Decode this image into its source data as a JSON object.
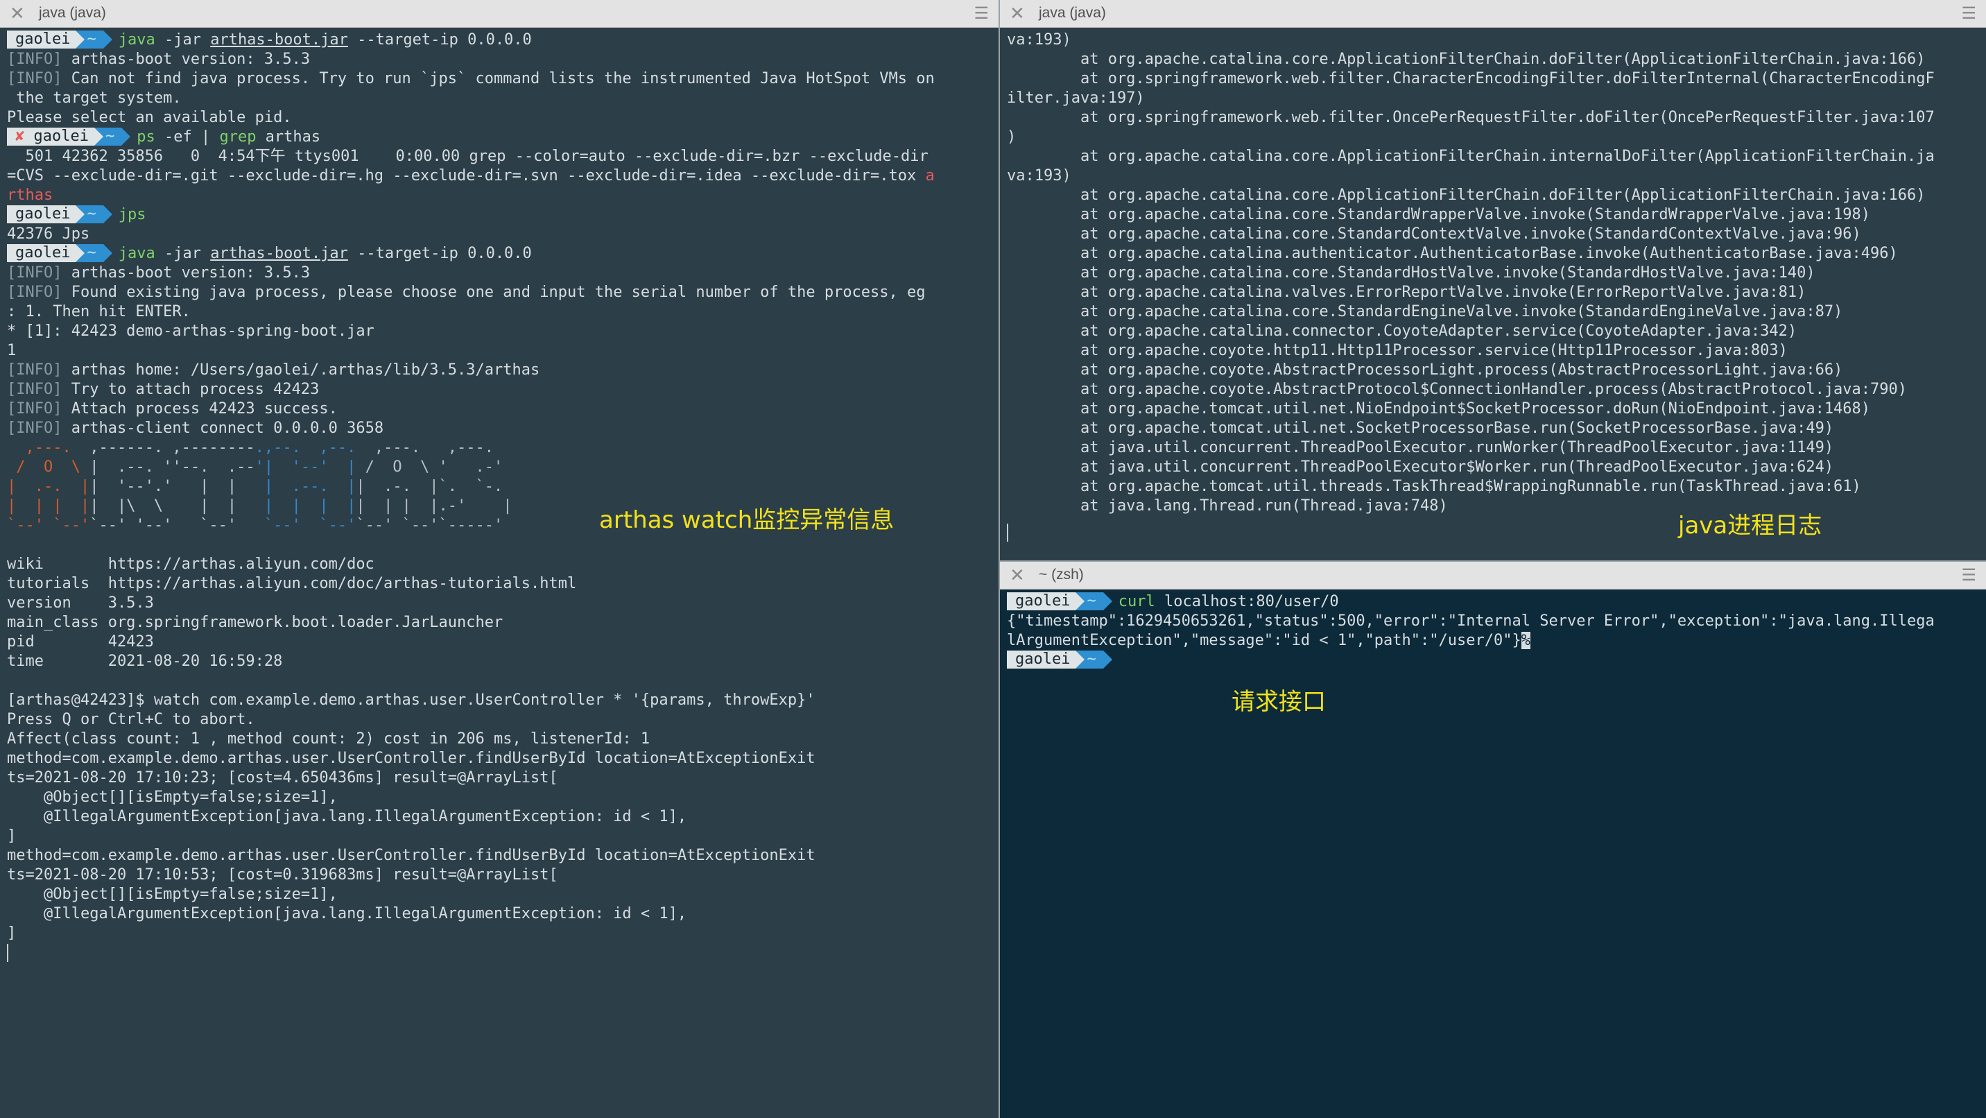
{
  "left_pane": {
    "title": "java (java)",
    "lines": [
      {
        "type": "prompt",
        "user": "gaolei",
        "dir": "~",
        "cmd": "java",
        "args_pre": " -jar ",
        "args_u": "arthas-boot.jar",
        "args_post": " --target-ip 0.0.0.0"
      },
      {
        "type": "text",
        "tag": "[INFO]",
        "text": " arthas-boot version: 3.5.3"
      },
      {
        "type": "text",
        "tag": "[INFO]",
        "text": " Can not find java process. Try to run `jps` command lists the instrumented Java HotSpot VMs on"
      },
      {
        "type": "text",
        "tag": "",
        "text": " the target system."
      },
      {
        "type": "text",
        "tag": "",
        "text": "Please select an available pid."
      },
      {
        "type": "prompt_err",
        "mark": "✘",
        "user": "gaolei",
        "dir": "~",
        "cmd": "ps",
        "args_pre": " -ef | ",
        "grep": "grep",
        "args_post": " arthas"
      },
      {
        "type": "text",
        "tag": "",
        "text": "  501 42362 35856   0  4:54下午 ttys001    0:00.00 grep --color=auto --exclude-dir=.bzr --exclude-dir"
      },
      {
        "type": "text",
        "tag": "",
        "text": "=CVS --exclude-dir=.git --exclude-dir=.hg --exclude-dir=.svn --exclude-dir=.idea --exclude-dir=.tox ",
        "red": "a"
      },
      {
        "type": "red",
        "text": "rthas"
      },
      {
        "type": "prompt",
        "user": "gaolei",
        "dir": "~",
        "cmd": "jps",
        "args_pre": "",
        "args_u": "",
        "args_post": ""
      },
      {
        "type": "text",
        "tag": "",
        "text": "42376 Jps"
      },
      {
        "type": "prompt",
        "user": "gaolei",
        "dir": "~",
        "cmd": "java",
        "args_pre": " -jar ",
        "args_u": "arthas-boot.jar",
        "args_post": " --target-ip 0.0.0.0"
      },
      {
        "type": "text",
        "tag": "[INFO]",
        "text": " arthas-boot version: 3.5.3"
      },
      {
        "type": "text",
        "tag": "[INFO]",
        "text": " Found existing java process, please choose one and input the serial number of the process, eg"
      },
      {
        "type": "text",
        "tag": "",
        "text": ": 1. Then hit ENTER."
      },
      {
        "type": "text",
        "tag": "",
        "text": "* [1]: 42423 demo-arthas-spring-boot.jar"
      },
      {
        "type": "text",
        "tag": "",
        "text": "1"
      },
      {
        "type": "text",
        "tag": "[INFO]",
        "text": " arthas home: /Users/gaolei/.arthas/lib/3.5.3/arthas"
      },
      {
        "type": "text",
        "tag": "[INFO]",
        "text": " Try to attach process 42423"
      },
      {
        "type": "text",
        "tag": "[INFO]",
        "text": " Attach process 42423 success."
      },
      {
        "type": "text",
        "tag": "[INFO]",
        "text": " arthas-client connect 0.0.0.0 3658"
      }
    ],
    "logo_lines": [
      "  ,---.  ,------. ,--------.,--.  ,--.  ,---.   ,---.",
      " /  O  \\ |  .--. ''--.  .--'|  '--'  | /  O  \\ '   .-'",
      "|  .-.  ||  '--'.'   |  |   |  .--.  ||  .-.  |`.  `-.",
      "|  | |  ||  |\\  \\    |  |   |  |  |  ||  | |  |.-'    |",
      "`--' `--'`--' '--'   `--'   `--'  `--'`--' `--'`-----'"
    ],
    "info_lines": [
      "",
      "wiki       https://arthas.aliyun.com/doc",
      "tutorials  https://arthas.aliyun.com/doc/arthas-tutorials.html",
      "version    3.5.3",
      "main_class org.springframework.boot.loader.JarLauncher",
      "pid        42423",
      "time       2021-08-20 16:59:28",
      "",
      "[arthas@42423]$ watch com.example.demo.arthas.user.UserController * '{params, throwExp}'",
      "Press Q or Ctrl+C to abort.",
      "Affect(class count: 1 , method count: 2) cost in 206 ms, listenerId: 1",
      "method=com.example.demo.arthas.user.UserController.findUserById location=AtExceptionExit",
      "ts=2021-08-20 17:10:23; [cost=4.650436ms] result=@ArrayList[",
      "    @Object[][isEmpty=false;size=1],",
      "    @IllegalArgumentException[java.lang.IllegalArgumentException: id < 1],",
      "]",
      "method=com.example.demo.arthas.user.UserController.findUserById location=AtExceptionExit",
      "ts=2021-08-20 17:10:53; [cost=0.319683ms] result=@ArrayList[",
      "    @Object[][isEmpty=false;size=1],",
      "    @IllegalArgumentException[java.lang.IllegalArgumentException: id < 1],",
      "]"
    ],
    "annotation": "arthas watch监控异常信息"
  },
  "right_top_pane": {
    "title": "java (java)",
    "lines": [
      "va:193)",
      "        at org.apache.catalina.core.ApplicationFilterChain.doFilter(ApplicationFilterChain.java:166)",
      "        at org.springframework.web.filter.CharacterEncodingFilter.doFilterInternal(CharacterEncodingF",
      "ilter.java:197)",
      "        at org.springframework.web.filter.OncePerRequestFilter.doFilter(OncePerRequestFilter.java:107",
      ")",
      "        at org.apache.catalina.core.ApplicationFilterChain.internalDoFilter(ApplicationFilterChain.ja",
      "va:193)",
      "        at org.apache.catalina.core.ApplicationFilterChain.doFilter(ApplicationFilterChain.java:166)",
      "        at org.apache.catalina.core.StandardWrapperValve.invoke(StandardWrapperValve.java:198)",
      "        at org.apache.catalina.core.StandardContextValve.invoke(StandardContextValve.java:96)",
      "        at org.apache.catalina.authenticator.AuthenticatorBase.invoke(AuthenticatorBase.java:496)",
      "        at org.apache.catalina.core.StandardHostValve.invoke(StandardHostValve.java:140)",
      "        at org.apache.catalina.valves.ErrorReportValve.invoke(ErrorReportValve.java:81)",
      "        at org.apache.catalina.core.StandardEngineValve.invoke(StandardEngineValve.java:87)",
      "        at org.apache.catalina.connector.CoyoteAdapter.service(CoyoteAdapter.java:342)",
      "        at org.apache.coyote.http11.Http11Processor.service(Http11Processor.java:803)",
      "        at org.apache.coyote.AbstractProcessorLight.process(AbstractProcessorLight.java:66)",
      "        at org.apache.coyote.AbstractProtocol$ConnectionHandler.process(AbstractProtocol.java:790)",
      "        at org.apache.tomcat.util.net.NioEndpoint$SocketProcessor.doRun(NioEndpoint.java:1468)",
      "        at org.apache.tomcat.util.net.SocketProcessorBase.run(SocketProcessorBase.java:49)",
      "        at java.util.concurrent.ThreadPoolExecutor.runWorker(ThreadPoolExecutor.java:1149)",
      "        at java.util.concurrent.ThreadPoolExecutor$Worker.run(ThreadPoolExecutor.java:624)",
      "        at org.apache.tomcat.util.threads.TaskThread$WrappingRunnable.run(TaskThread.java:61)",
      "        at java.lang.Thread.run(Thread.java:748)"
    ],
    "annotation": "java进程日志"
  },
  "right_bottom_pane": {
    "title": "~ (zsh)",
    "prompt1": {
      "user": "gaolei",
      "dir": "~",
      "cmd": "curl",
      "args": " localhost:80/user/0"
    },
    "output": [
      "{\"timestamp\":1629450653261,\"status\":500,\"error\":\"Internal Server Error\",\"exception\":\"java.lang.Illega",
      "lArgumentException\",\"message\":\"id < 1\",\"path\":\"/user/0\"}"
    ],
    "output_end": "%",
    "prompt2": {
      "user": "gaolei",
      "dir": "~"
    },
    "annotation": "请求接口"
  },
  "icons": {
    "close": "close-icon",
    "menu": "menu-icon"
  },
  "colors": {
    "accent_blue": "#2e8fd1",
    "annotation_yellow": "#f2e21b",
    "error_red": "#e85a5a",
    "cmd_green": "#7fd169"
  }
}
